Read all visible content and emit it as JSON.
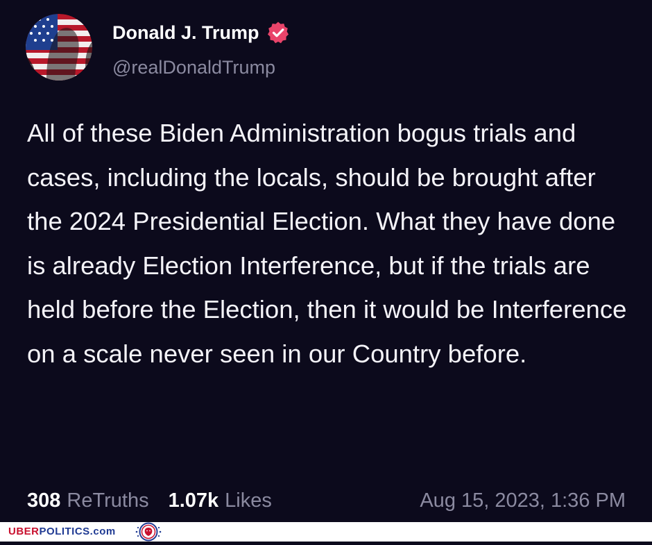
{
  "post": {
    "display_name": "Donald J. Trump",
    "handle": "@realDonaldTrump",
    "verified_icon": "verified-badge-icon",
    "text": "All of these Biden Administration bogus trials and cases, including the locals, should be brought after the 2024 Presidential Election. What they have done is already Election Interference, but if the trials are held before the Election, then it would be Interference on a scale never seen in our Country before.",
    "retruths_count": "308",
    "retruths_label": "ReTruths",
    "likes_count": "1.07k",
    "likes_label": "Likes",
    "timestamp": "Aug 15, 2023, 1:36 PM"
  },
  "footer": {
    "brand_part1": "UBER",
    "brand_part2": "POLITICS.com",
    "logo_icon": "uberpolitics-lion-logo-icon"
  },
  "colors": {
    "background": "#0c0a1c",
    "text": "#f4f3f8",
    "muted": "#8b8aa0",
    "verified": "#e9446a",
    "brand_red": "#c8102e",
    "brand_blue": "#1f3a93"
  }
}
